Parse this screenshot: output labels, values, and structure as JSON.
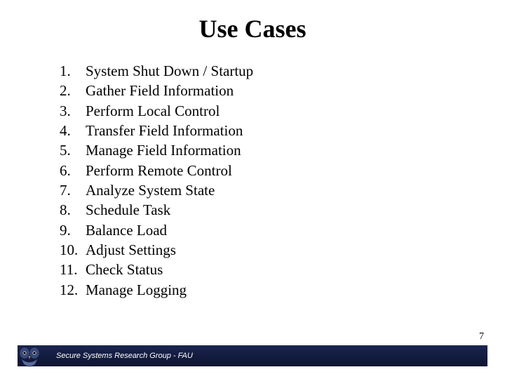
{
  "title": "Use Cases",
  "list": {
    "items": [
      {
        "num": "1.",
        "text": "System Shut Down / Startup"
      },
      {
        "num": "2.",
        "text": "Gather Field Information"
      },
      {
        "num": "3.",
        "text": "Perform Local Control"
      },
      {
        "num": "4.",
        "text": "Transfer Field Information"
      },
      {
        "num": "5.",
        "text": "Manage Field Information"
      },
      {
        "num": "6.",
        "text": "Perform Remote Control"
      },
      {
        "num": "7.",
        "text": "Analyze System State"
      },
      {
        "num": "8.",
        "text": "Schedule Task"
      },
      {
        "num": "9.",
        "text": "Balance Load"
      },
      {
        "num": "10.",
        "text": "Adjust Settings"
      },
      {
        "num": "11.",
        "text": "Check Status"
      },
      {
        "num": "12.",
        "text": "Manage Logging"
      }
    ]
  },
  "footer": {
    "text": "Secure Systems Research Group - FAU"
  },
  "page_number": "7"
}
